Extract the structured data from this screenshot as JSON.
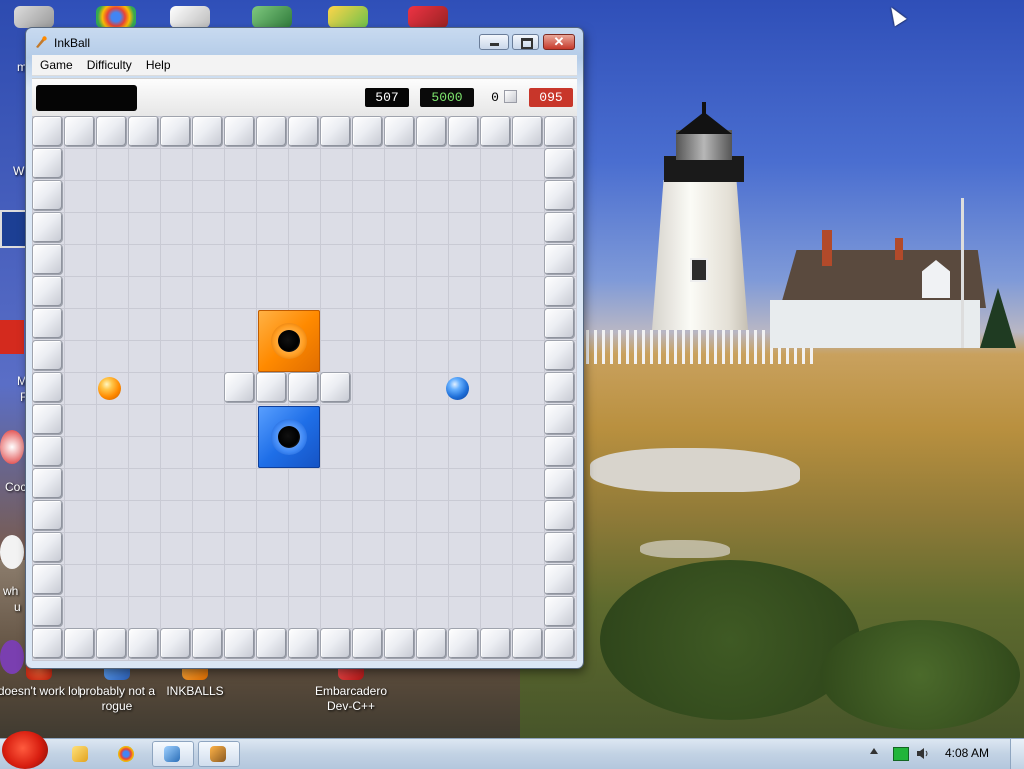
{
  "window": {
    "title": "InkBall",
    "menu": [
      "Game",
      "Difficulty",
      "Help"
    ],
    "close_glyph": "✕"
  },
  "status": {
    "message": "",
    "score": "507",
    "target": "5000",
    "balls_used": "0",
    "time": "095"
  },
  "board": {
    "holes": [
      {
        "color": "orange",
        "name": "orange-hole"
      },
      {
        "color": "blue",
        "name": "blue-hole"
      }
    ],
    "balls": [
      {
        "color": "orange",
        "name": "orange-ball"
      },
      {
        "color": "blue",
        "name": "blue-ball"
      }
    ]
  },
  "desktop": {
    "icons": [
      {
        "label": "doesn't work lol"
      },
      {
        "label": "probably not a rogue"
      },
      {
        "label": "INKBALLS"
      },
      {
        "label": "Embarcadero Dev-C++"
      }
    ],
    "edge_labels": [
      "m",
      "W",
      "M",
      "F",
      "Coc",
      "wh",
      "u"
    ]
  },
  "taskbar": {
    "clock": "4:08 AM",
    "items": [
      "file-explorer",
      "chrome",
      "network-app",
      "inkball"
    ]
  },
  "colors": {
    "orange_accent": "#ff8a00",
    "blue_accent": "#1f6fe8",
    "timer_bg": "#c8362a",
    "target_text": "#7ee56e"
  }
}
